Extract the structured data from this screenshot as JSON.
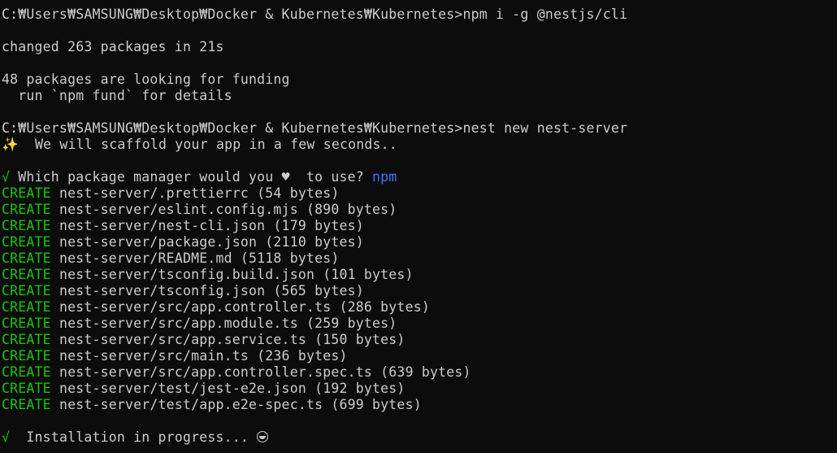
{
  "terminal": {
    "cmd1": {
      "prompt": "C:₩Users₩SAMSUNG₩Desktop₩Docker & Kubernetes₩Kubernetes>",
      "command": "npm i -g @nestjs/cli"
    },
    "output1": {
      "changed": "changed 263 packages in 21s",
      "funding": "48 packages are looking for funding",
      "fund_hint": "  run `npm fund` for details"
    },
    "cmd2": {
      "prompt": "C:₩Users₩SAMSUNG₩Desktop₩Docker & Kubernetes₩Kubernetes>",
      "command": "nest new nest-server"
    },
    "scaffold": {
      "sparkle": "✨",
      "text": "  We will scaffold your app in a few seconds.."
    },
    "question": {
      "check": "√",
      "text_before": " Which package manager would you ",
      "heart": "♥",
      "text_after": "  to use? ",
      "answer": "npm"
    },
    "create_label": "CREATE",
    "files": [
      " nest-server/.prettierrc (54 bytes)",
      " nest-server/eslint.config.mjs (890 bytes)",
      " nest-server/nest-cli.json (179 bytes)",
      " nest-server/package.json (2110 bytes)",
      " nest-server/README.md (5118 bytes)",
      " nest-server/tsconfig.build.json (101 bytes)",
      " nest-server/tsconfig.json (565 bytes)",
      " nest-server/src/app.controller.ts (286 bytes)",
      " nest-server/src/app.module.ts (259 bytes)",
      " nest-server/src/app.service.ts (150 bytes)",
      " nest-server/src/main.ts (236 bytes)",
      " nest-server/src/app.controller.spec.ts (639 bytes)",
      " nest-server/test/jest-e2e.json (192 bytes)",
      " nest-server/test/app.e2e-spec.ts (699 bytes)"
    ],
    "install": {
      "check": "√",
      "text": "  Installation in progress... "
    },
    "colors": {
      "background": "#0c0c0c",
      "foreground": "#cccccc",
      "green": "#16c60c",
      "blue": "#3b78ff"
    }
  }
}
